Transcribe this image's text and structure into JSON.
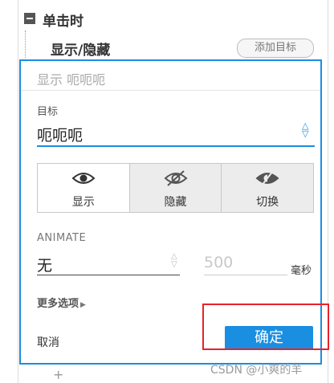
{
  "event": {
    "label": "单击时",
    "collapse_icon": "collapse-minus-icon"
  },
  "action": {
    "label": "显示/隐藏",
    "add_target_label": "添加目标"
  },
  "panel": {
    "header_summary": "显示 呃呃呃",
    "target_label": "目标",
    "target_value": "呃呃呃",
    "visibility_options": [
      {
        "label": "显示",
        "icon": "eye-icon",
        "selected": true
      },
      {
        "label": "隐藏",
        "icon": "eye-slash-icon",
        "selected": false
      },
      {
        "label": "切换",
        "icon": "eye-toggle-icon",
        "selected": false
      }
    ],
    "animate_label": "ANIMATE",
    "animate_value": "无",
    "duration_placeholder": "500",
    "duration_unit": "毫秒",
    "more_options_label": "更多选项",
    "cancel_label": "取消",
    "confirm_label": "确定"
  },
  "add_row_icon": "plus-icon",
  "watermark": "CSDN @小爽的羊",
  "colors": {
    "accent": "#1a8ee0",
    "highlight": "#e8222b",
    "segment_bg": "#ececec"
  }
}
